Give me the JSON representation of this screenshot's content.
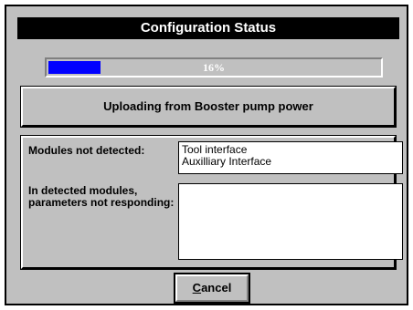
{
  "dialog": {
    "title": "Configuration Status"
  },
  "progress": {
    "value_fraction": 0.16,
    "label": "16%",
    "fill_color": "#0000ff"
  },
  "status": {
    "message": "Uploading from Booster pump power"
  },
  "modules": {
    "not_detected_label": "Modules not detected:",
    "not_detected_items": [
      "Tool interface",
      "Auxilliary Interface"
    ],
    "not_responding_label": "In detected modules, parameters not responding:",
    "not_responding_items": []
  },
  "buttons": {
    "cancel_accel": "C",
    "cancel_rest": "ancel"
  }
}
